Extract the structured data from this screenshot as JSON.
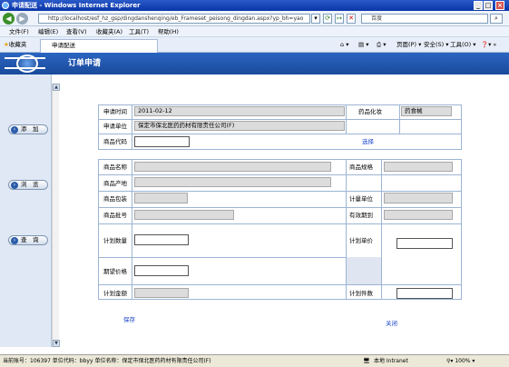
{
  "window": {
    "title": "申请配送 - Windows Internet Explorer"
  },
  "browser": {
    "address": "http://localhost/esf_hz_gsp/dingdanshenqing/eb_Frameset_peisong_dingdan.aspx?yp_bh=yao",
    "search_placeholder": "百度",
    "menu": [
      "文件(F)",
      "编辑(E)",
      "查看(V)",
      "收藏夹(A)",
      "工具(T)",
      "帮助(H)"
    ],
    "favorites_label": "收藏夹",
    "tab_label": "申请配送",
    "toolbar_right": [
      "页面(P)",
      "安全(S)",
      "工具(O)"
    ]
  },
  "app": {
    "title": "订单申请"
  },
  "sidebar": {
    "buttons": [
      "添　加",
      "浏　览",
      "查　询"
    ]
  },
  "form": {
    "apply_time_label": "申请时间",
    "apply_time_value": "2011-02-12",
    "category_label": "药品化妆",
    "category_value": "药食械",
    "apply_unit_label": "申请单位",
    "apply_unit_value": "保定市保北医药药材有限责任公司(F)",
    "code_label": "商品代码",
    "select_link": "选择",
    "name_label": "商品名称",
    "spec_label": "商品规格",
    "origin_label": "商品产地",
    "pack_label": "商品包装",
    "measure_unit_label": "计量单位",
    "batch_label": "商品批号",
    "expiry_label": "有效期到",
    "plan_qty_label": "计划数量",
    "plan_price_label": "计划单价",
    "expect_price_label": "期望价格",
    "plan_amount_label": "计划金额",
    "plan_pieces_label": "计划件数",
    "save_link": "保存",
    "close_link": "关闭"
  },
  "status": {
    "text": "当前账号：106397 单位代码：bbyy  单位名称：保定市保北医药药材有限责任公司(F)",
    "zone": "本地 Intranet",
    "zoom": "100%"
  }
}
